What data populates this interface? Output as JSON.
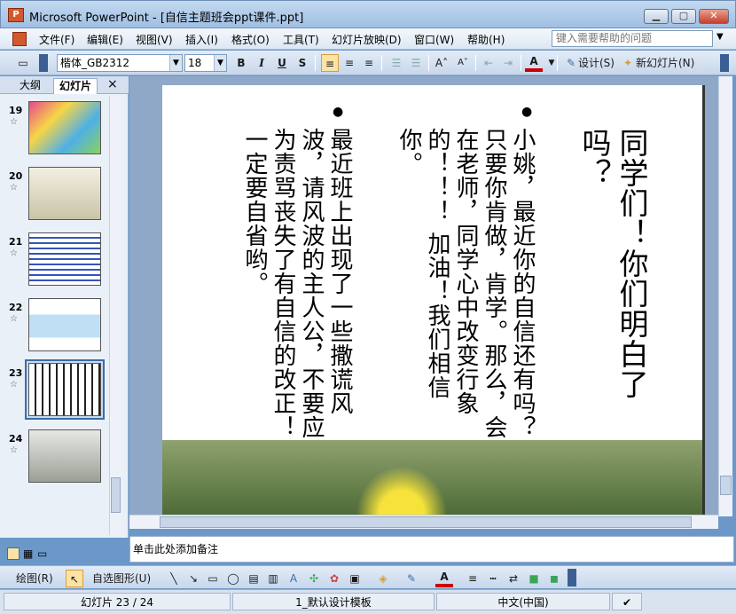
{
  "window": {
    "title": "Microsoft PowerPoint - [自信主题班会ppt课件.ppt]",
    "app_icon": "P"
  },
  "menu": [
    "文件(F)",
    "编辑(E)",
    "视图(V)",
    "插入(I)",
    "格式(O)",
    "工具(T)",
    "幻灯片放映(D)",
    "窗口(W)",
    "帮助(H)"
  ],
  "help_placeholder": "键入需要帮助的问题",
  "format": {
    "font": "楷体_GB2312",
    "size": "18",
    "bold": "B",
    "italic": "I",
    "underline": "U",
    "shadow": "S",
    "design": "设计(S)",
    "new_slide": "新幻灯片(N)",
    "font_color_label": "A"
  },
  "left_panel": {
    "tabs": [
      "大纲",
      "幻灯片"
    ],
    "close_label": "×",
    "slides": [
      "19",
      "20",
      "21",
      "22",
      "23",
      "24"
    ]
  },
  "slide": {
    "title": "同学们！你们明白了吗？",
    "bullets": [
      "小姚，最近你的自信还有吗？只要你肯做，肯学。那么，会在老师，同学心中改变行象的！！！ 加油！我们相信你。",
      "最近班上出现了一些撒谎风波，请风波的主人公，不要应为责骂丧失了有自信的改正！一定要自省哟。"
    ]
  },
  "notes_placeholder": "单击此处添加备注",
  "drawbar": {
    "draw": "绘图(R)",
    "autoshapes": "自选图形(U)"
  },
  "status": {
    "slide": "幻灯片 23 / 24",
    "template": "1_默认设计模板",
    "language": "中文(中国)"
  },
  "colors": {
    "accent": "#3a6ea5",
    "font_color": "#cc0000"
  }
}
